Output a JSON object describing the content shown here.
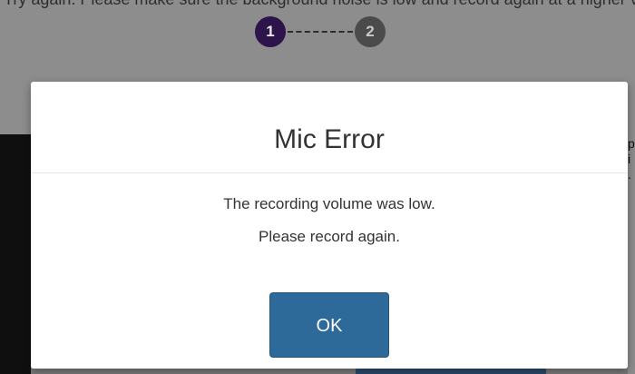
{
  "background": {
    "cut_text": "Try again. Please make sure the background noise is low and record again at a higher volume.",
    "side_glyphs": "p  i ."
  },
  "stepper": {
    "steps": [
      {
        "label": "1",
        "state": "active",
        "color": "#2d144a"
      },
      {
        "label": "2",
        "state": "inactive",
        "color": "#4b4b4b"
      }
    ]
  },
  "dialog": {
    "title": "Mic Error",
    "message_line1": "The recording volume was low.",
    "message_line2": "Please record again.",
    "ok_label": "OK",
    "ok_color": "#2d6a9a"
  }
}
